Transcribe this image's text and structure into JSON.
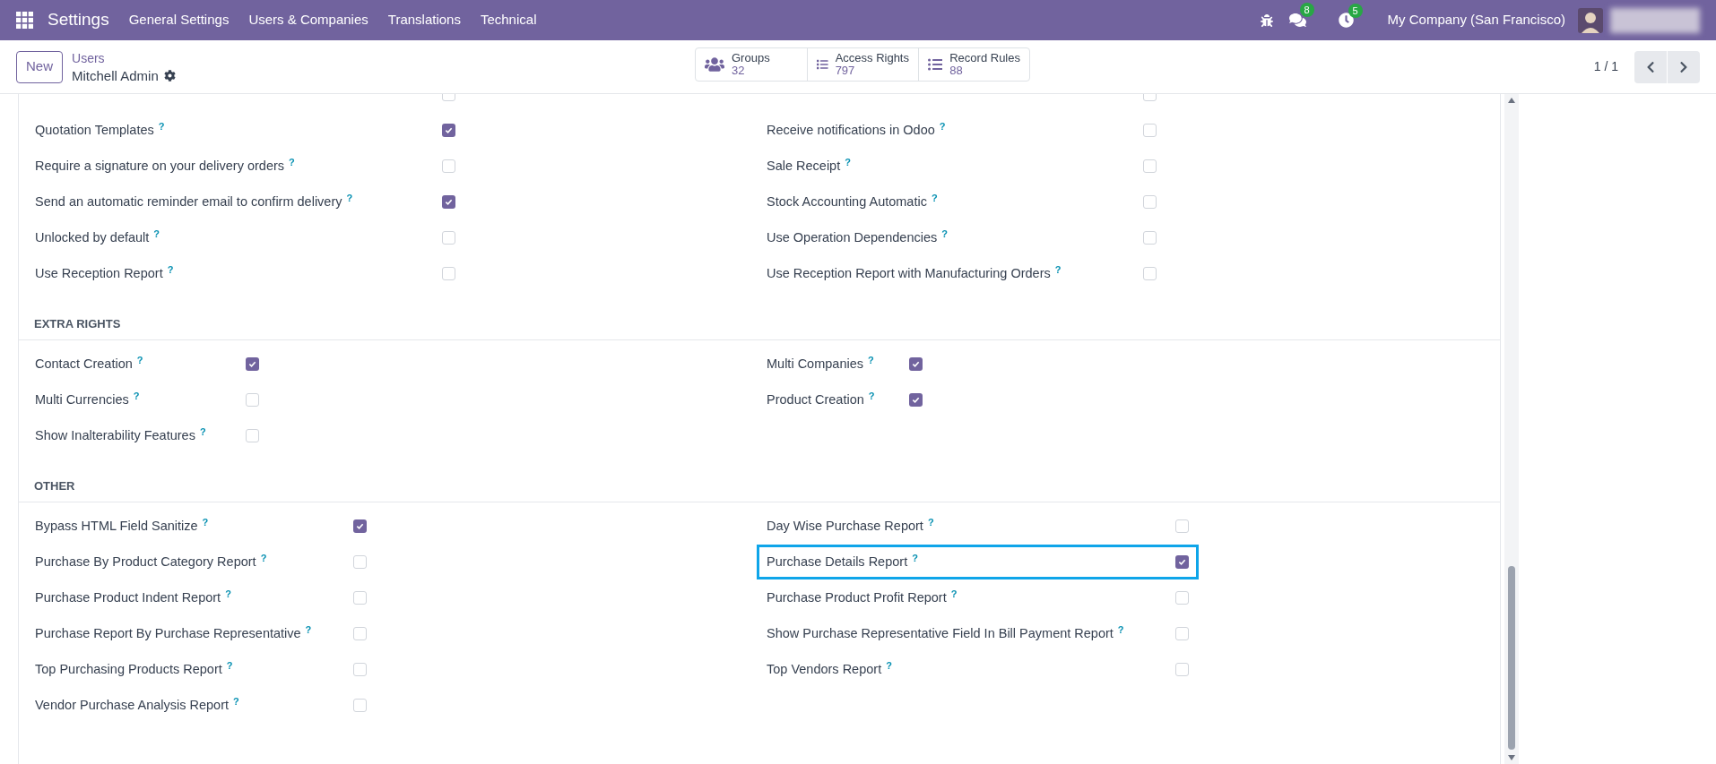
{
  "navbar": {
    "title": "Settings",
    "menu": [
      "General Settings",
      "Users & Companies",
      "Translations",
      "Technical"
    ],
    "messages_count": "8",
    "activities_count": "5",
    "company": "My Company (San Francisco)"
  },
  "control_panel": {
    "new_button": "New",
    "breadcrumb": "Users",
    "record": "Mitchell Admin",
    "stats": [
      {
        "kind": "groups",
        "label": "Groups",
        "value": "32"
      },
      {
        "kind": "list",
        "label": "Access Rights",
        "value": "797"
      },
      {
        "kind": "rules",
        "label": "Record Rules",
        "value": "88"
      }
    ],
    "pager": "1 / 1"
  },
  "sections": [
    {
      "rows": [
        {
          "left": {
            "checked": false
          },
          "right": {
            "checked": false
          }
        },
        {
          "left": {
            "label": "Quotation Templates",
            "help": "?",
            "checked": true
          },
          "right": {
            "label": "Receive notifications in Odoo",
            "help": "?",
            "checked": false
          }
        },
        {
          "left": {
            "label": "Require a signature on your delivery orders",
            "help": "?",
            "checked": false
          },
          "right": {
            "label": "Sale Receipt",
            "help": "?",
            "checked": false
          }
        },
        {
          "left": {
            "label": "Send an automatic reminder email to confirm delivery",
            "help": "?",
            "checked": true
          },
          "right": {
            "label": "Stock Accounting Automatic",
            "help": "?",
            "checked": false
          }
        },
        {
          "left": {
            "label": "Unlocked by default",
            "help": "?",
            "checked": false
          },
          "right": {
            "label": "Use Operation Dependencies",
            "help": "?",
            "checked": false
          }
        },
        {
          "left": {
            "label": "Use Reception Report",
            "help": "?",
            "checked": false
          },
          "right": {
            "label": "Use Reception Report with Manufacturing Orders",
            "help": "?",
            "checked": false
          }
        }
      ]
    },
    {
      "title": "EXTRA RIGHTS",
      "rows": [
        {
          "left": {
            "label": "Contact Creation",
            "help": "?",
            "checked": true
          },
          "right": {
            "label": "Multi Companies",
            "help": "?",
            "checked": true
          }
        },
        {
          "left": {
            "label": "Multi Currencies",
            "help": "?",
            "checked": false
          },
          "right": {
            "label": "Product Creation",
            "help": "?",
            "checked": true
          }
        },
        {
          "left": {
            "label": "Show Inalterability Features",
            "help": "?",
            "checked": false
          }
        }
      ]
    },
    {
      "title": "OTHER",
      "rows": [
        {
          "left": {
            "label": "Bypass HTML Field Sanitize",
            "help": "?",
            "checked": true
          },
          "right": {
            "label": "Day Wise Purchase Report",
            "help": "?",
            "checked": false
          }
        },
        {
          "left": {
            "label": "Purchase By Product Category Report",
            "help": "?",
            "checked": false
          },
          "right": {
            "label": "Purchase Details Report",
            "help": "?",
            "checked": true,
            "highlighted": true
          }
        },
        {
          "left": {
            "label": "Purchase Product Indent Report",
            "help": "?",
            "checked": false
          },
          "right": {
            "label": "Purchase Product Profit Report",
            "help": "?",
            "checked": false
          }
        },
        {
          "left": {
            "label": "Purchase Report By Purchase Representative",
            "help": "?",
            "checked": false
          },
          "right": {
            "label": "Show Purchase Representative Field In Bill Payment Report",
            "help": "?",
            "checked": false
          }
        },
        {
          "left": {
            "label": "Top Purchasing Products Report",
            "help": "?",
            "checked": false
          },
          "right": {
            "label": "Top Vendors Report",
            "help": "?",
            "checked": false
          }
        },
        {
          "left": {
            "label": "Vendor Purchase Analysis Report",
            "help": "?",
            "checked": false
          }
        }
      ]
    }
  ]
}
